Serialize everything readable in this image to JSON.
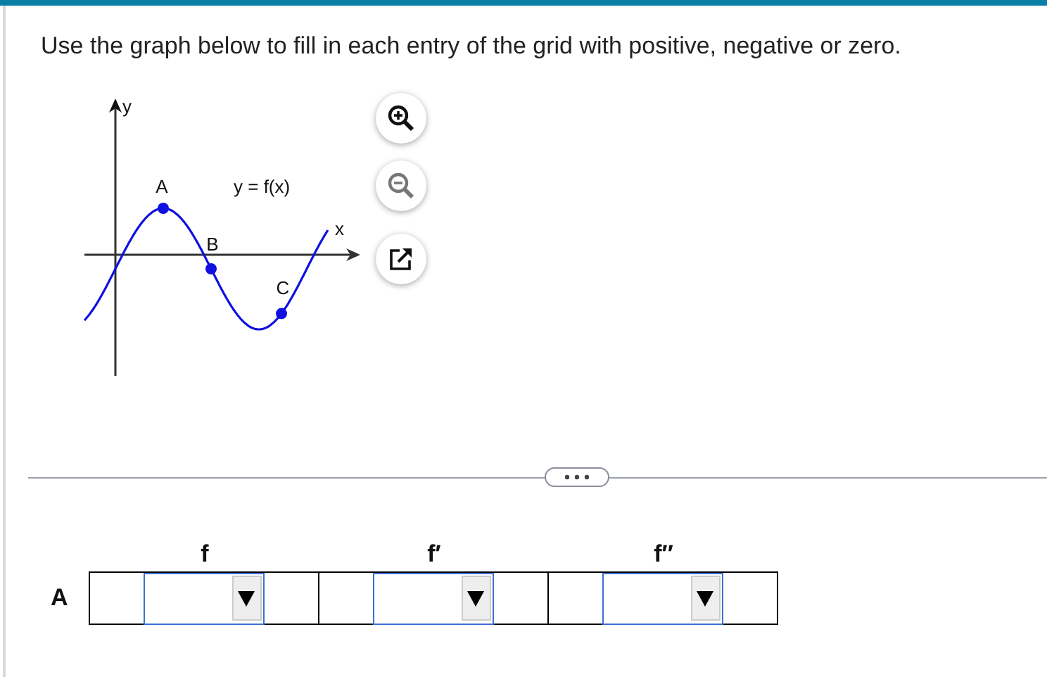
{
  "question": "Use the graph below to fill in each entry of the grid with positive, negative or zero.",
  "graph": {
    "y_axis_label": "y",
    "x_axis_label": "x",
    "function_label": "y = f(x)",
    "points": [
      {
        "label": "A"
      },
      {
        "label": "B"
      },
      {
        "label": "C"
      }
    ]
  },
  "grid": {
    "columns": [
      "f",
      "f′",
      "f′′"
    ],
    "rows": [
      {
        "label": "A"
      }
    ]
  }
}
